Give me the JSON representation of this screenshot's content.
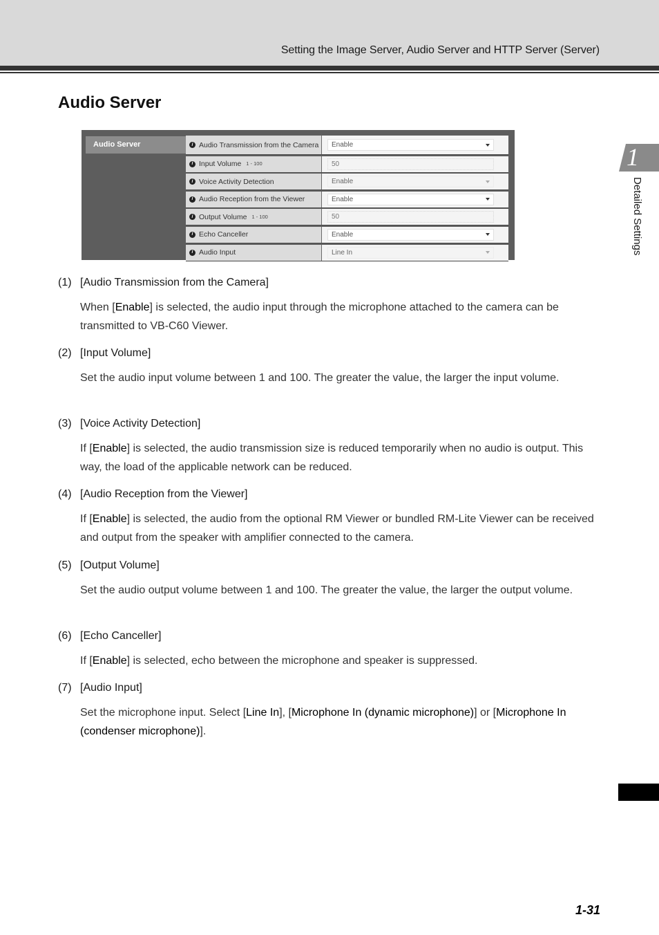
{
  "header": {
    "title": "Setting the Image Server, Audio Server and HTTP Server (Server)"
  },
  "section": {
    "title": "Audio Server"
  },
  "panel": {
    "menu_label": "Audio Server",
    "rows": [
      {
        "label": "Audio Transmission from the Camera",
        "range": "",
        "control": "select",
        "value": "Enable",
        "enabled": true
      },
      {
        "label": "Input Volume",
        "range": "1 - 100",
        "control": "text",
        "value": "50",
        "enabled": false
      },
      {
        "label": "Voice Activity Detection",
        "range": "",
        "control": "select",
        "value": "Enable",
        "enabled": false
      },
      {
        "label": "Audio Reception from the Viewer",
        "range": "",
        "control": "select",
        "value": "Enable",
        "enabled": true
      },
      {
        "label": "Output Volume",
        "range": "1 - 100",
        "control": "text",
        "value": "50",
        "enabled": false
      },
      {
        "label": "Echo Canceller",
        "range": "",
        "control": "select",
        "value": "Enable",
        "enabled": true
      },
      {
        "label": "Audio Input",
        "range": "",
        "control": "select",
        "value": "Line In",
        "enabled": false
      }
    ]
  },
  "items": [
    {
      "num": "(1)",
      "title": "[Audio Transmission from the Camera]",
      "body": [
        {
          "t": "When ["
        },
        {
          "b": "Enable"
        },
        {
          "t": "] is selected, the audio input through the microphone attached to the camera can be transmitted to VB-C60 Viewer."
        }
      ]
    },
    {
      "num": "(2)",
      "title": "[Input Volume]",
      "body": [
        {
          "t": "Set the audio input volume between 1 and 100. The greater the value, the larger the input volume."
        }
      ]
    },
    {
      "num": "(3)",
      "title": "[Voice Activity Detection]",
      "body": [
        {
          "t": "If ["
        },
        {
          "b": "Enable"
        },
        {
          "t": "] is selected, the audio transmission size is reduced temporarily when no audio is output. This way, the load of the applicable network can be reduced."
        }
      ]
    },
    {
      "num": "(4)",
      "title": "[Audio Reception from the Viewer]",
      "body": [
        {
          "t": "If ["
        },
        {
          "b": "Enable"
        },
        {
          "t": "] is selected, the audio from the optional RM Viewer or bundled RM-Lite Viewer can be received and output from the speaker with amplifier connected to the camera."
        }
      ]
    },
    {
      "num": "(5)",
      "title": "[Output Volume]",
      "body": [
        {
          "t": "Set the audio output volume between 1 and 100. The greater the value, the larger the output volume."
        }
      ]
    },
    {
      "num": "(6)",
      "title": "[Echo Canceller]",
      "body": [
        {
          "t": "If ["
        },
        {
          "b": "Enable"
        },
        {
          "t": "] is selected, echo between the microphone and speaker is suppressed."
        }
      ]
    },
    {
      "num": "(7)",
      "title": "[Audio Input]",
      "body": [
        {
          "t": "Set the microphone input. Select ["
        },
        {
          "b": "Line In"
        },
        {
          "t": "], ["
        },
        {
          "b": "Microphone In (dynamic microphone)"
        },
        {
          "t": "] or ["
        },
        {
          "b": "Microphone In (condenser microphone)"
        },
        {
          "t": "]."
        }
      ]
    }
  ],
  "side": {
    "chapter_number": "1",
    "chapter_label": "Detailed Settings"
  },
  "footer": {
    "page_number": "1-31"
  }
}
